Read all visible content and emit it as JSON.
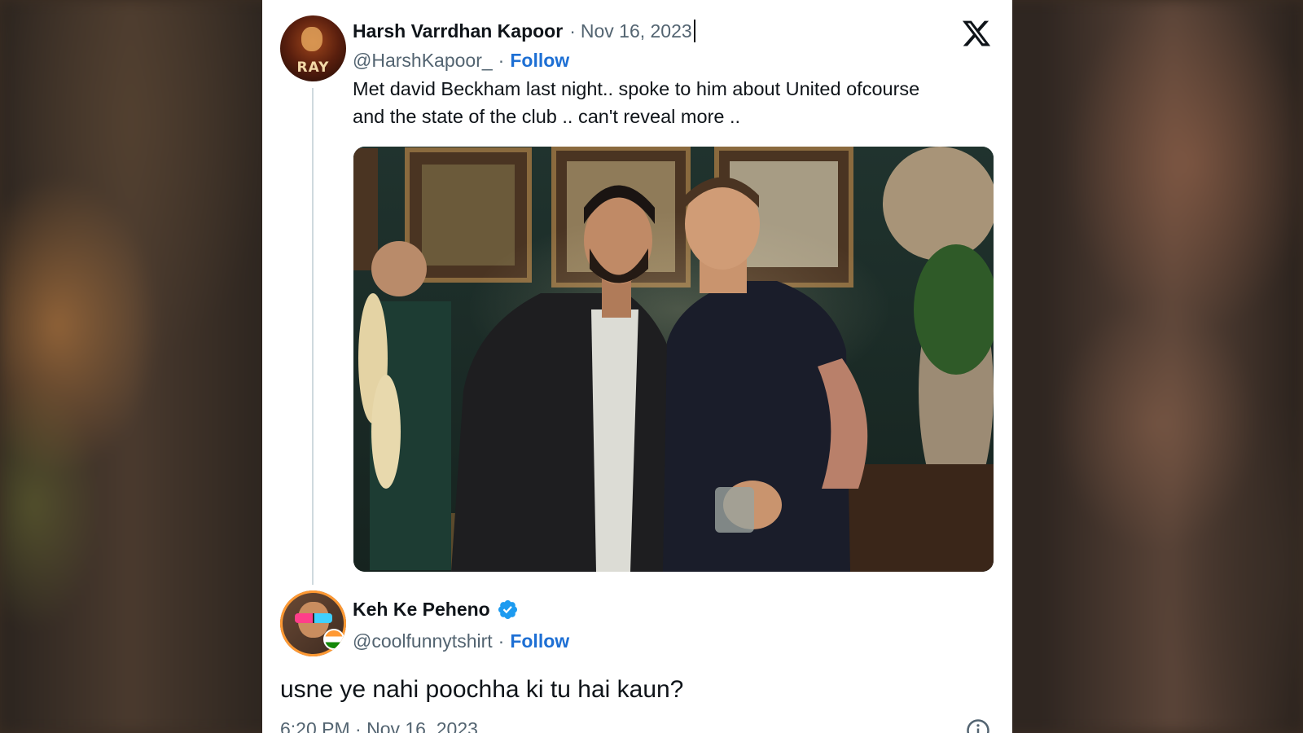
{
  "tweet": {
    "author_name": "Harsh Varrdhan Kapoor",
    "date": "Nov 16, 2023",
    "separator": "·",
    "handle": "@HarshKapoor_",
    "follow_label": "Follow",
    "text_line_1": "Met david Beckham last night.. spoke to him about United ofcourse",
    "text_line_2": "and the state of the club .. can't  reveal more ..",
    "avatar_text": "RAY",
    "image_icon": "photo"
  },
  "reply": {
    "author_name": "Keh Ke Peheno",
    "verified_icon": "verified-badge-icon",
    "separator": "·",
    "handle": "@coolfunnytshirt",
    "follow_label": "Follow",
    "text": "usne ye nahi poochha ki tu hai kaun?",
    "timestamp": "6:20 PM · Nov 16, 2023"
  },
  "colors": {
    "link_blue": "#1d6fd4",
    "verified_blue": "#1d9bf0",
    "text_primary": "#0f1419",
    "text_secondary": "#536471"
  },
  "icons": [
    "x-logo-icon",
    "verified-badge-icon",
    "info-icon"
  ]
}
